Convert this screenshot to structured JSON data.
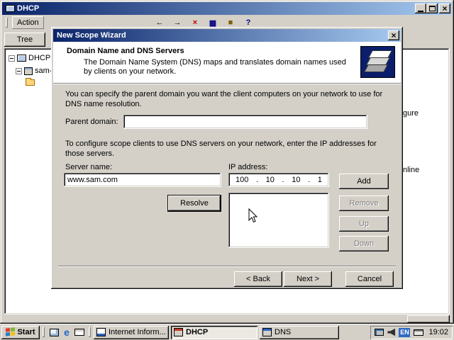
{
  "console": {
    "title": "DHCP",
    "menu": {
      "action": "Action"
    },
    "tabs": {
      "tree": "Tree"
    },
    "tree": {
      "root": "DHCP",
      "server": "sam-"
    },
    "fragments": {
      "line1": "gure",
      "line2": "nline"
    }
  },
  "wizard": {
    "title": "New Scope Wizard",
    "header_title": "Domain Name and DNS Servers",
    "header_subtitle": "The Domain Name System (DNS) maps and translates domain names used by clients on your network.",
    "intro": "You can specify the parent domain you want the client computers on your network to use for DNS name resolution.",
    "parent_domain_label": "Parent domain:",
    "parent_domain_value": "",
    "dns_intro": "To configure scope clients to use DNS servers on your network, enter the IP addresses for those servers.",
    "server_name_label": "Server name:",
    "server_name_value": "www.sam.com",
    "ip_label": "IP address:",
    "ip": {
      "o1": "100",
      "o2": "10",
      "o3": "10",
      "o4": "1",
      "dot": "."
    },
    "buttons": {
      "add": "Add",
      "remove": "Remove",
      "up": "Up",
      "down": "Down",
      "resolve": "Resolve"
    },
    "nav": {
      "back": "< Back",
      "next": "Next >",
      "cancel": "Cancel"
    }
  },
  "taskbar": {
    "start_label": "Start",
    "tasks": [
      {
        "label": "Internet Inform..."
      },
      {
        "label": "DHCP"
      },
      {
        "label": "DNS"
      }
    ],
    "tray": {
      "lang": "EN",
      "time": "19:02"
    }
  },
  "icons": {
    "close": "×",
    "ie": "e",
    "toolbar": [
      {
        "name": "back",
        "glyph": "←"
      },
      {
        "name": "forward",
        "glyph": "→"
      },
      {
        "name": "delete",
        "glyph": "×"
      },
      {
        "name": "properties",
        "glyph": "▦"
      },
      {
        "name": "export-list",
        "glyph": "■"
      },
      {
        "name": "help",
        "glyph": "?"
      }
    ]
  }
}
